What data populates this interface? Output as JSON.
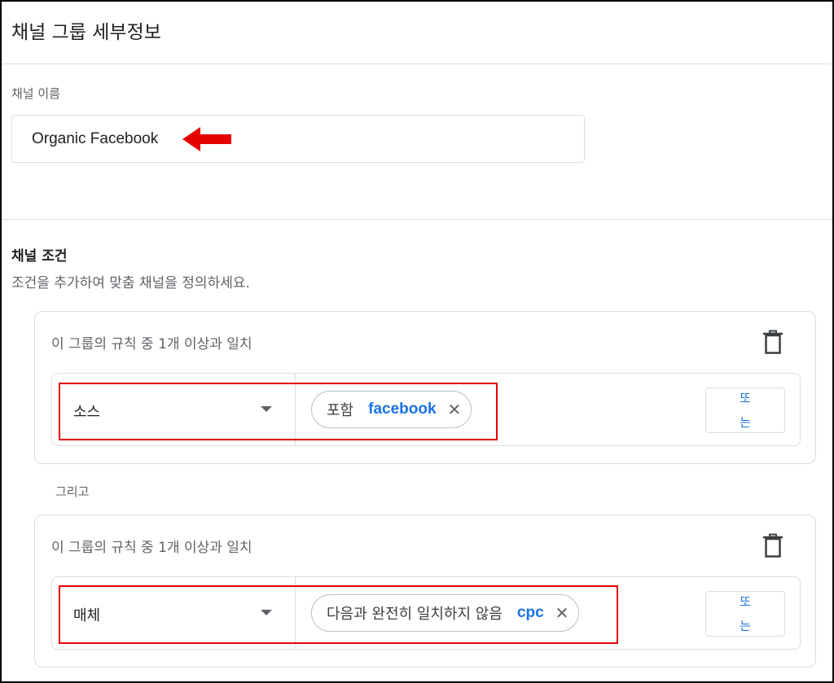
{
  "page": {
    "title": "채널 그룹 세부정보"
  },
  "channel_name": {
    "label": "채널 이름",
    "value": "Organic Facebook"
  },
  "conditions": {
    "title": "채널 조건",
    "description": "조건을 추가하여 맞춤 채널을 정의하세요."
  },
  "groups": [
    {
      "header": "이 그룹의 규칙 중 1개 이상과 일치",
      "dimension": "소스",
      "operator": "포함",
      "value": "facebook",
      "or_label_line1": "또",
      "or_label_line2": "는"
    },
    {
      "header": "이 그룹의 규칙 중 1개 이상과 일치",
      "dimension": "매체",
      "operator": "다음과 완전히 일치하지 않음",
      "value": "cpc",
      "or_label_line1": "또",
      "or_label_line2": "는"
    }
  ],
  "and_label": "그리고",
  "icons": {
    "delete": "trash-icon",
    "dropdown": "caret-down-icon",
    "remove_chip": "close-icon",
    "annotation_arrow": "arrow-left-icon"
  },
  "colors": {
    "accent": "#1a73e8",
    "annotation": "#e50000",
    "border": "#dadce0"
  }
}
